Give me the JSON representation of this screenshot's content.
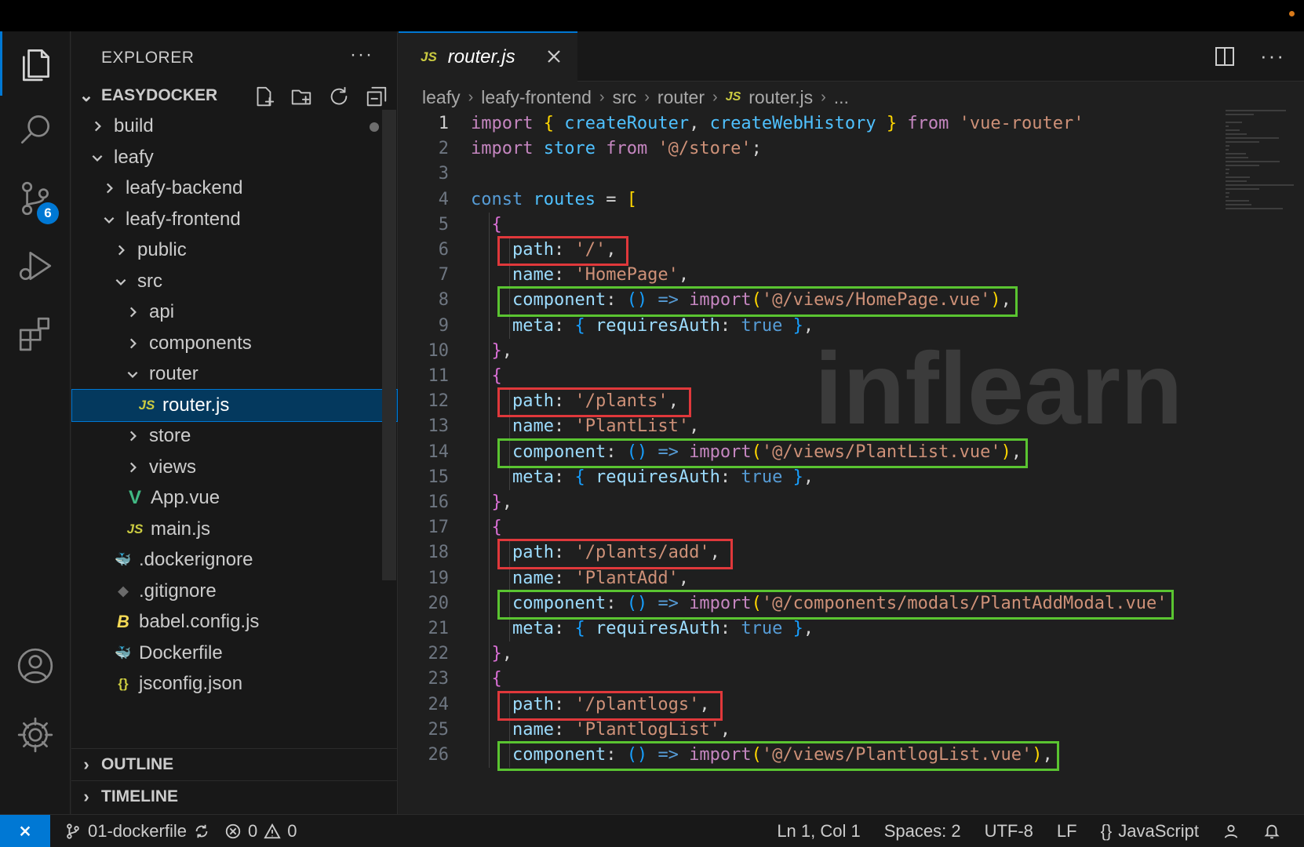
{
  "explorer": {
    "title": "EXPLORER",
    "more": "···",
    "root": "EASYDOCKER",
    "tree": [
      {
        "label": "build",
        "kind": "folder",
        "expanded": false,
        "level": 1,
        "modified": true
      },
      {
        "label": "leafy",
        "kind": "folder",
        "expanded": true,
        "level": 1
      },
      {
        "label": "leafy-backend",
        "kind": "folder",
        "expanded": false,
        "level": 2
      },
      {
        "label": "leafy-frontend",
        "kind": "folder",
        "expanded": true,
        "level": 2
      },
      {
        "label": "public",
        "kind": "folder",
        "expanded": false,
        "level": 3
      },
      {
        "label": "src",
        "kind": "folder",
        "expanded": true,
        "level": 3
      },
      {
        "label": "api",
        "kind": "folder",
        "expanded": false,
        "level": 4
      },
      {
        "label": "components",
        "kind": "folder",
        "expanded": false,
        "level": 4
      },
      {
        "label": "router",
        "kind": "folder",
        "expanded": true,
        "level": 4
      },
      {
        "label": "router.js",
        "kind": "js",
        "level": 5,
        "selected": true
      },
      {
        "label": "store",
        "kind": "folder",
        "expanded": false,
        "level": 4
      },
      {
        "label": "views",
        "kind": "folder",
        "expanded": false,
        "level": 4
      },
      {
        "label": "App.vue",
        "kind": "vue",
        "level": 4
      },
      {
        "label": "main.js",
        "kind": "js",
        "level": 4
      },
      {
        "label": ".dockerignore",
        "kind": "docker",
        "level": 3
      },
      {
        "label": ".gitignore",
        "kind": "git",
        "level": 3
      },
      {
        "label": "babel.config.js",
        "kind": "babel",
        "level": 3
      },
      {
        "label": "Dockerfile",
        "kind": "docker",
        "level": 3
      },
      {
        "label": "jsconfig.json",
        "kind": "json",
        "level": 3
      }
    ],
    "outline": "OUTLINE",
    "timeline": "TIMELINE"
  },
  "activity": {
    "badge": "6",
    "icons": [
      "files-icon",
      "search-icon",
      "source-control-icon",
      "run-debug-icon",
      "extensions-icon",
      "account-icon",
      "settings-gear-icon"
    ]
  },
  "editor": {
    "tab": {
      "label": "router.js",
      "icon": "JS"
    },
    "breadcrumb": [
      "leafy",
      "leafy-frontend",
      "src",
      "router",
      "router.js",
      "..."
    ],
    "lines": [
      [
        [
          "import ",
          "k-kw"
        ],
        [
          "{ ",
          "k-b1"
        ],
        [
          "createRouter",
          "k-var"
        ],
        [
          ", ",
          "k-pl"
        ],
        [
          "createWebHistory",
          "k-var"
        ],
        [
          " } ",
          "k-b1"
        ],
        [
          "from ",
          "k-kw"
        ],
        [
          "'vue-router'",
          "k-str"
        ]
      ],
      [
        [
          "import ",
          "k-kw"
        ],
        [
          "store ",
          "k-var"
        ],
        [
          "from ",
          "k-kw"
        ],
        [
          "'@/store'",
          "k-str"
        ],
        [
          ";",
          "k-pl"
        ]
      ],
      [],
      [
        [
          "const ",
          "k-dec"
        ],
        [
          "routes ",
          "k-var"
        ],
        [
          "= ",
          "k-pl"
        ],
        [
          "[",
          "k-b1"
        ]
      ],
      [
        [
          "  {",
          "k-b2"
        ]
      ],
      [
        [
          "    path",
          "k-prop"
        ],
        [
          ": ",
          "k-pl"
        ],
        [
          "'/'",
          "k-str"
        ],
        [
          ",",
          "k-pl"
        ]
      ],
      [
        [
          "    name",
          "k-prop"
        ],
        [
          ": ",
          "k-pl"
        ],
        [
          "'HomePage'",
          "k-str"
        ],
        [
          ",",
          "k-pl"
        ]
      ],
      [
        [
          "    component",
          "k-prop"
        ],
        [
          ": ",
          "k-pl"
        ],
        [
          "() ",
          "k-b3"
        ],
        [
          "=> ",
          "k-dec"
        ],
        [
          "import",
          "k-kw"
        ],
        [
          "(",
          "k-b1"
        ],
        [
          "'@/views/HomePage.vue'",
          "k-str"
        ],
        [
          ")",
          "k-b1"
        ],
        [
          ",",
          "k-pl"
        ]
      ],
      [
        [
          "    meta",
          "k-prop"
        ],
        [
          ": ",
          "k-pl"
        ],
        [
          "{ ",
          "k-b3"
        ],
        [
          "requiresAuth",
          "k-prop"
        ],
        [
          ": ",
          "k-pl"
        ],
        [
          "true ",
          "k-dec"
        ],
        [
          "}",
          "k-b3"
        ],
        [
          ",",
          "k-pl"
        ]
      ],
      [
        [
          "  }",
          "k-b2"
        ],
        [
          ",",
          "k-pl"
        ]
      ],
      [
        [
          "  {",
          "k-b2"
        ]
      ],
      [
        [
          "    path",
          "k-prop"
        ],
        [
          ": ",
          "k-pl"
        ],
        [
          "'/plants'",
          "k-str"
        ],
        [
          ",",
          "k-pl"
        ]
      ],
      [
        [
          "    name",
          "k-prop"
        ],
        [
          ": ",
          "k-pl"
        ],
        [
          "'PlantList'",
          "k-str"
        ],
        [
          ",",
          "k-pl"
        ]
      ],
      [
        [
          "    component",
          "k-prop"
        ],
        [
          ": ",
          "k-pl"
        ],
        [
          "() ",
          "k-b3"
        ],
        [
          "=> ",
          "k-dec"
        ],
        [
          "import",
          "k-kw"
        ],
        [
          "(",
          "k-b1"
        ],
        [
          "'@/views/PlantList.vue'",
          "k-str"
        ],
        [
          ")",
          "k-b1"
        ],
        [
          ",",
          "k-pl"
        ]
      ],
      [
        [
          "    meta",
          "k-prop"
        ],
        [
          ": ",
          "k-pl"
        ],
        [
          "{ ",
          "k-b3"
        ],
        [
          "requiresAuth",
          "k-prop"
        ],
        [
          ": ",
          "k-pl"
        ],
        [
          "true ",
          "k-dec"
        ],
        [
          "}",
          "k-b3"
        ],
        [
          ",",
          "k-pl"
        ]
      ],
      [
        [
          "  }",
          "k-b2"
        ],
        [
          ",",
          "k-pl"
        ]
      ],
      [
        [
          "  {",
          "k-b2"
        ]
      ],
      [
        [
          "    path",
          "k-prop"
        ],
        [
          ": ",
          "k-pl"
        ],
        [
          "'/plants/add'",
          "k-str"
        ],
        [
          ",",
          "k-pl"
        ]
      ],
      [
        [
          "    name",
          "k-prop"
        ],
        [
          ": ",
          "k-pl"
        ],
        [
          "'PlantAdd'",
          "k-str"
        ],
        [
          ",",
          "k-pl"
        ]
      ],
      [
        [
          "    component",
          "k-prop"
        ],
        [
          ": ",
          "k-pl"
        ],
        [
          "() ",
          "k-b3"
        ],
        [
          "=> ",
          "k-dec"
        ],
        [
          "import",
          "k-kw"
        ],
        [
          "(",
          "k-b1"
        ],
        [
          "'@/components/modals/PlantAddModal.vue'",
          "k-str"
        ]
      ],
      [
        [
          "    meta",
          "k-prop"
        ],
        [
          ": ",
          "k-pl"
        ],
        [
          "{ ",
          "k-b3"
        ],
        [
          "requiresAuth",
          "k-prop"
        ],
        [
          ": ",
          "k-pl"
        ],
        [
          "true ",
          "k-dec"
        ],
        [
          "}",
          "k-b3"
        ],
        [
          ",",
          "k-pl"
        ]
      ],
      [
        [
          "  }",
          "k-b2"
        ],
        [
          ",",
          "k-pl"
        ]
      ],
      [
        [
          "  {",
          "k-b2"
        ]
      ],
      [
        [
          "    path",
          "k-prop"
        ],
        [
          ": ",
          "k-pl"
        ],
        [
          "'/plantlogs'",
          "k-str"
        ],
        [
          ",",
          "k-pl"
        ]
      ],
      [
        [
          "    name",
          "k-prop"
        ],
        [
          ": ",
          "k-pl"
        ],
        [
          "'PlantlogList'",
          "k-str"
        ],
        [
          ",",
          "k-pl"
        ]
      ],
      [
        [
          "    component",
          "k-prop"
        ],
        [
          ": ",
          "k-pl"
        ],
        [
          "() ",
          "k-b3"
        ],
        [
          "=> ",
          "k-dec"
        ],
        [
          "import",
          "k-kw"
        ],
        [
          "(",
          "k-b1"
        ],
        [
          "'@/views/PlantlogList.vue'",
          "k-str"
        ],
        [
          ")",
          "k-b1"
        ],
        [
          ",",
          "k-pl"
        ]
      ]
    ],
    "highlights": {
      "red_lines": [
        6,
        12,
        18,
        24
      ],
      "green_lines": [
        8,
        14,
        20,
        26
      ]
    },
    "watermark": "inflearn"
  },
  "status": {
    "branch": "01-dockerfile",
    "errors": "0",
    "warnings": "0",
    "position": "Ln 1, Col 1",
    "spaces": "Spaces: 2",
    "encoding": "UTF-8",
    "eol": "LF",
    "language": "JavaScript",
    "language_prefix": "{}"
  },
  "colors": {
    "accent": "#0078d4",
    "highlight_red": "#e0383b",
    "highlight_green": "#5ac431"
  }
}
